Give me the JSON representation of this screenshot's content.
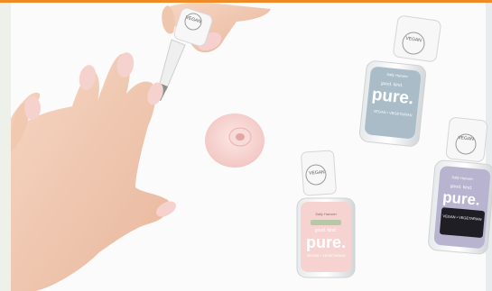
{
  "colors": {
    "accent": "#f08a24",
    "skin": "#f2c9b0",
    "polish_pink": "#f6d3d0",
    "polish_blue": "#a9bcc8",
    "polish_lilac": "#b8b3cf",
    "cap": "#f5f5f5"
  },
  "bottles": [
    {
      "cap_badge": "VEGAN",
      "brand": "Sally Hansen",
      "tagline": "good. kind.",
      "name": "pure.",
      "claims": "VEGAN • VEGETARIAN"
    },
    {
      "cap_badge": "VEGAN",
      "brand": "Sally Hansen",
      "tagline": "good. kind.",
      "name": "pure.",
      "claims": "VEGAN • VEGETARIAN"
    },
    {
      "cap_badge": "VEGAN",
      "brand": "Sally Hansen",
      "tagline": "good. kind.",
      "name": "pure.",
      "claims": "VEGAN • VEGETARIAN"
    }
  ],
  "brush_badge": "VEGAN"
}
